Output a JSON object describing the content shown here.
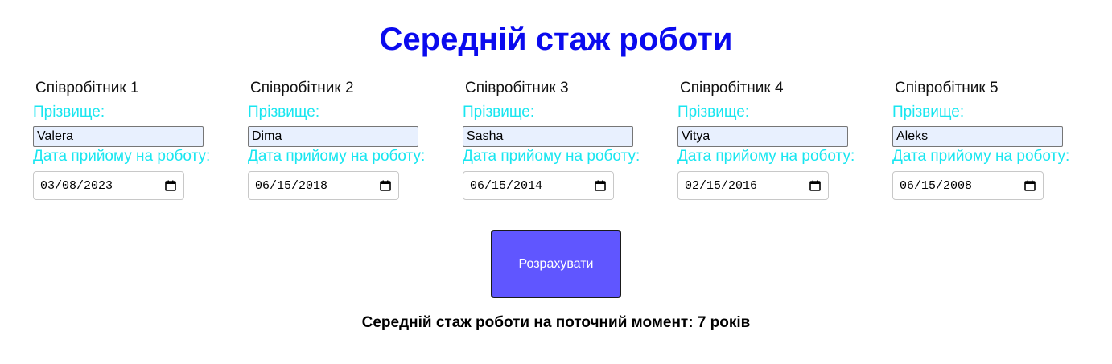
{
  "page": {
    "title": "Середній стаж роботи"
  },
  "form": {
    "surname_label": "Прізвище:",
    "hire_date_label": "Дата прийому на роботу:"
  },
  "employees": [
    {
      "header": "Співробітник 1",
      "surname": "Valera",
      "hire_date": "03/08/2023"
    },
    {
      "header": "Співробітник 2",
      "surname": "Dima",
      "hire_date": "06/15/2018"
    },
    {
      "header": "Співробітник 3",
      "surname": "Sasha",
      "hire_date": "06/15/2014"
    },
    {
      "header": "Співробітник 4",
      "surname": "Vitya",
      "hire_date": "02/15/2016"
    },
    {
      "header": "Співробітник 5",
      "surname": "Aleks",
      "hire_date": "06/15/2008"
    }
  ],
  "actions": {
    "calculate_label": "Розрахувати"
  },
  "result": {
    "text": "Середній стаж роботи на поточний момент: 7 років"
  },
  "colors": {
    "title": "#0a0aee",
    "labels": "#19e6f0",
    "button_bg": "#6056ff",
    "input_bg": "#e8f0fe"
  },
  "icons": {
    "date_picker": "calendar-icon"
  }
}
